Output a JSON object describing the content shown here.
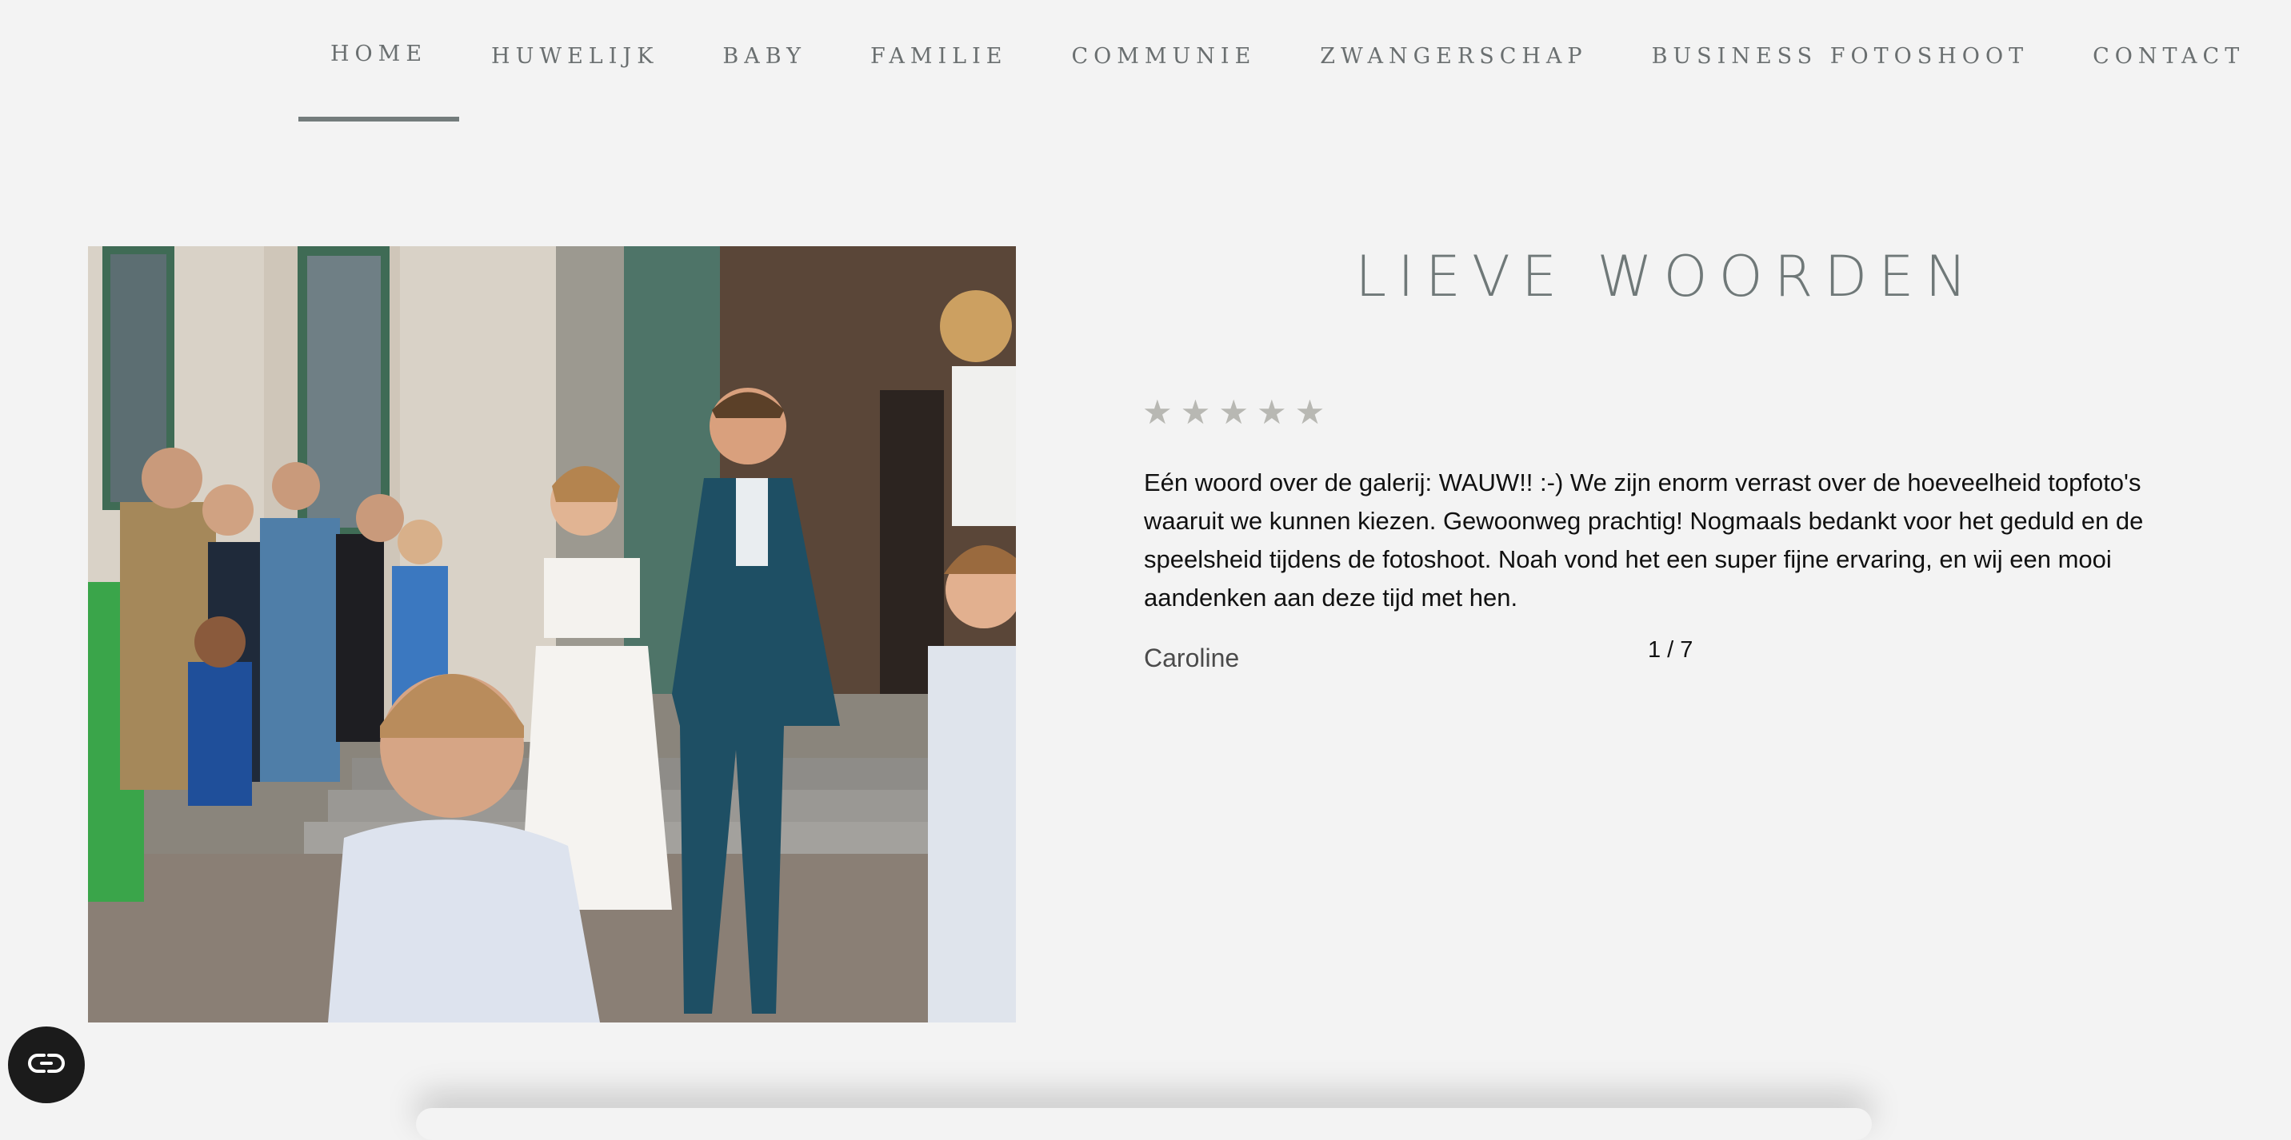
{
  "nav": {
    "items": [
      {
        "label": "HOME",
        "active": true
      },
      {
        "label": "HUWELIJK",
        "active": false
      },
      {
        "label": "BABY",
        "active": false
      },
      {
        "label": "FAMILIE",
        "active": false
      },
      {
        "label": "COMMUNIE",
        "active": false
      },
      {
        "label": "ZWANGERSCHAP",
        "active": false
      },
      {
        "label": "BUSINESS FOTOSHOOT",
        "active": false
      },
      {
        "label": "CONTACT",
        "active": false
      }
    ]
  },
  "testimonials": {
    "heading": "LIEVE WOORDEN",
    "rating": 5,
    "review": "Eén woord over de galerij: WAUW!! :-) We zijn enorm verrast over de hoeveelheid topfoto's waaruit we kunnen kiezen. Gewoonweg prachtig! Nogmaals bedankt voor het geduld en de speelsheid tijdens de fotoshoot. Noah vond het een super fijne ervaring, en wij een mooi aandenken aan deze tijd met hen.",
    "author": "Caroline",
    "counter": "1 / 7"
  },
  "photo": {
    "description_icon": "wedding-photo"
  },
  "float_button": {
    "icon": "infinity-link-icon"
  },
  "colors": {
    "background": "#f3f3f3",
    "nav_text": "#6a6f70",
    "heading": "#6f7878",
    "star": "#b8b8b3",
    "active_underline": "#737c7c"
  }
}
